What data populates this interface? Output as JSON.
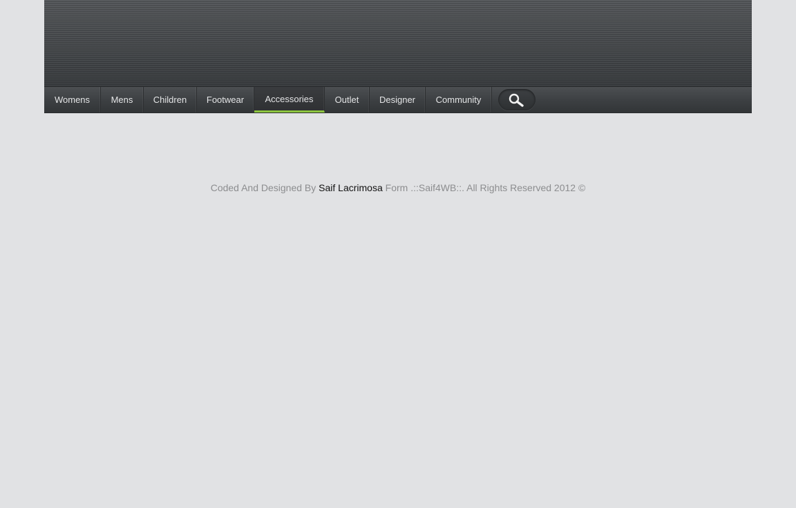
{
  "nav": {
    "items": [
      {
        "label": "Womens"
      },
      {
        "label": "Mens"
      },
      {
        "label": "Children"
      },
      {
        "label": "Footwear"
      },
      {
        "label": "Accessories",
        "active": true
      },
      {
        "label": "Outlet"
      },
      {
        "label": "Designer"
      },
      {
        "label": "Community"
      }
    ],
    "search_icon": "magnifier-icon",
    "active_color": "#8dc63f"
  },
  "footer": {
    "prefix": "Coded And Designed By",
    "author": "Saif Lacrimosa",
    "suffix": "Form .::Saif4WB::. All Rights Reserved 2012 ©"
  },
  "colors": {
    "background": "#e1e2e4",
    "navbar": "#3c3f42"
  }
}
